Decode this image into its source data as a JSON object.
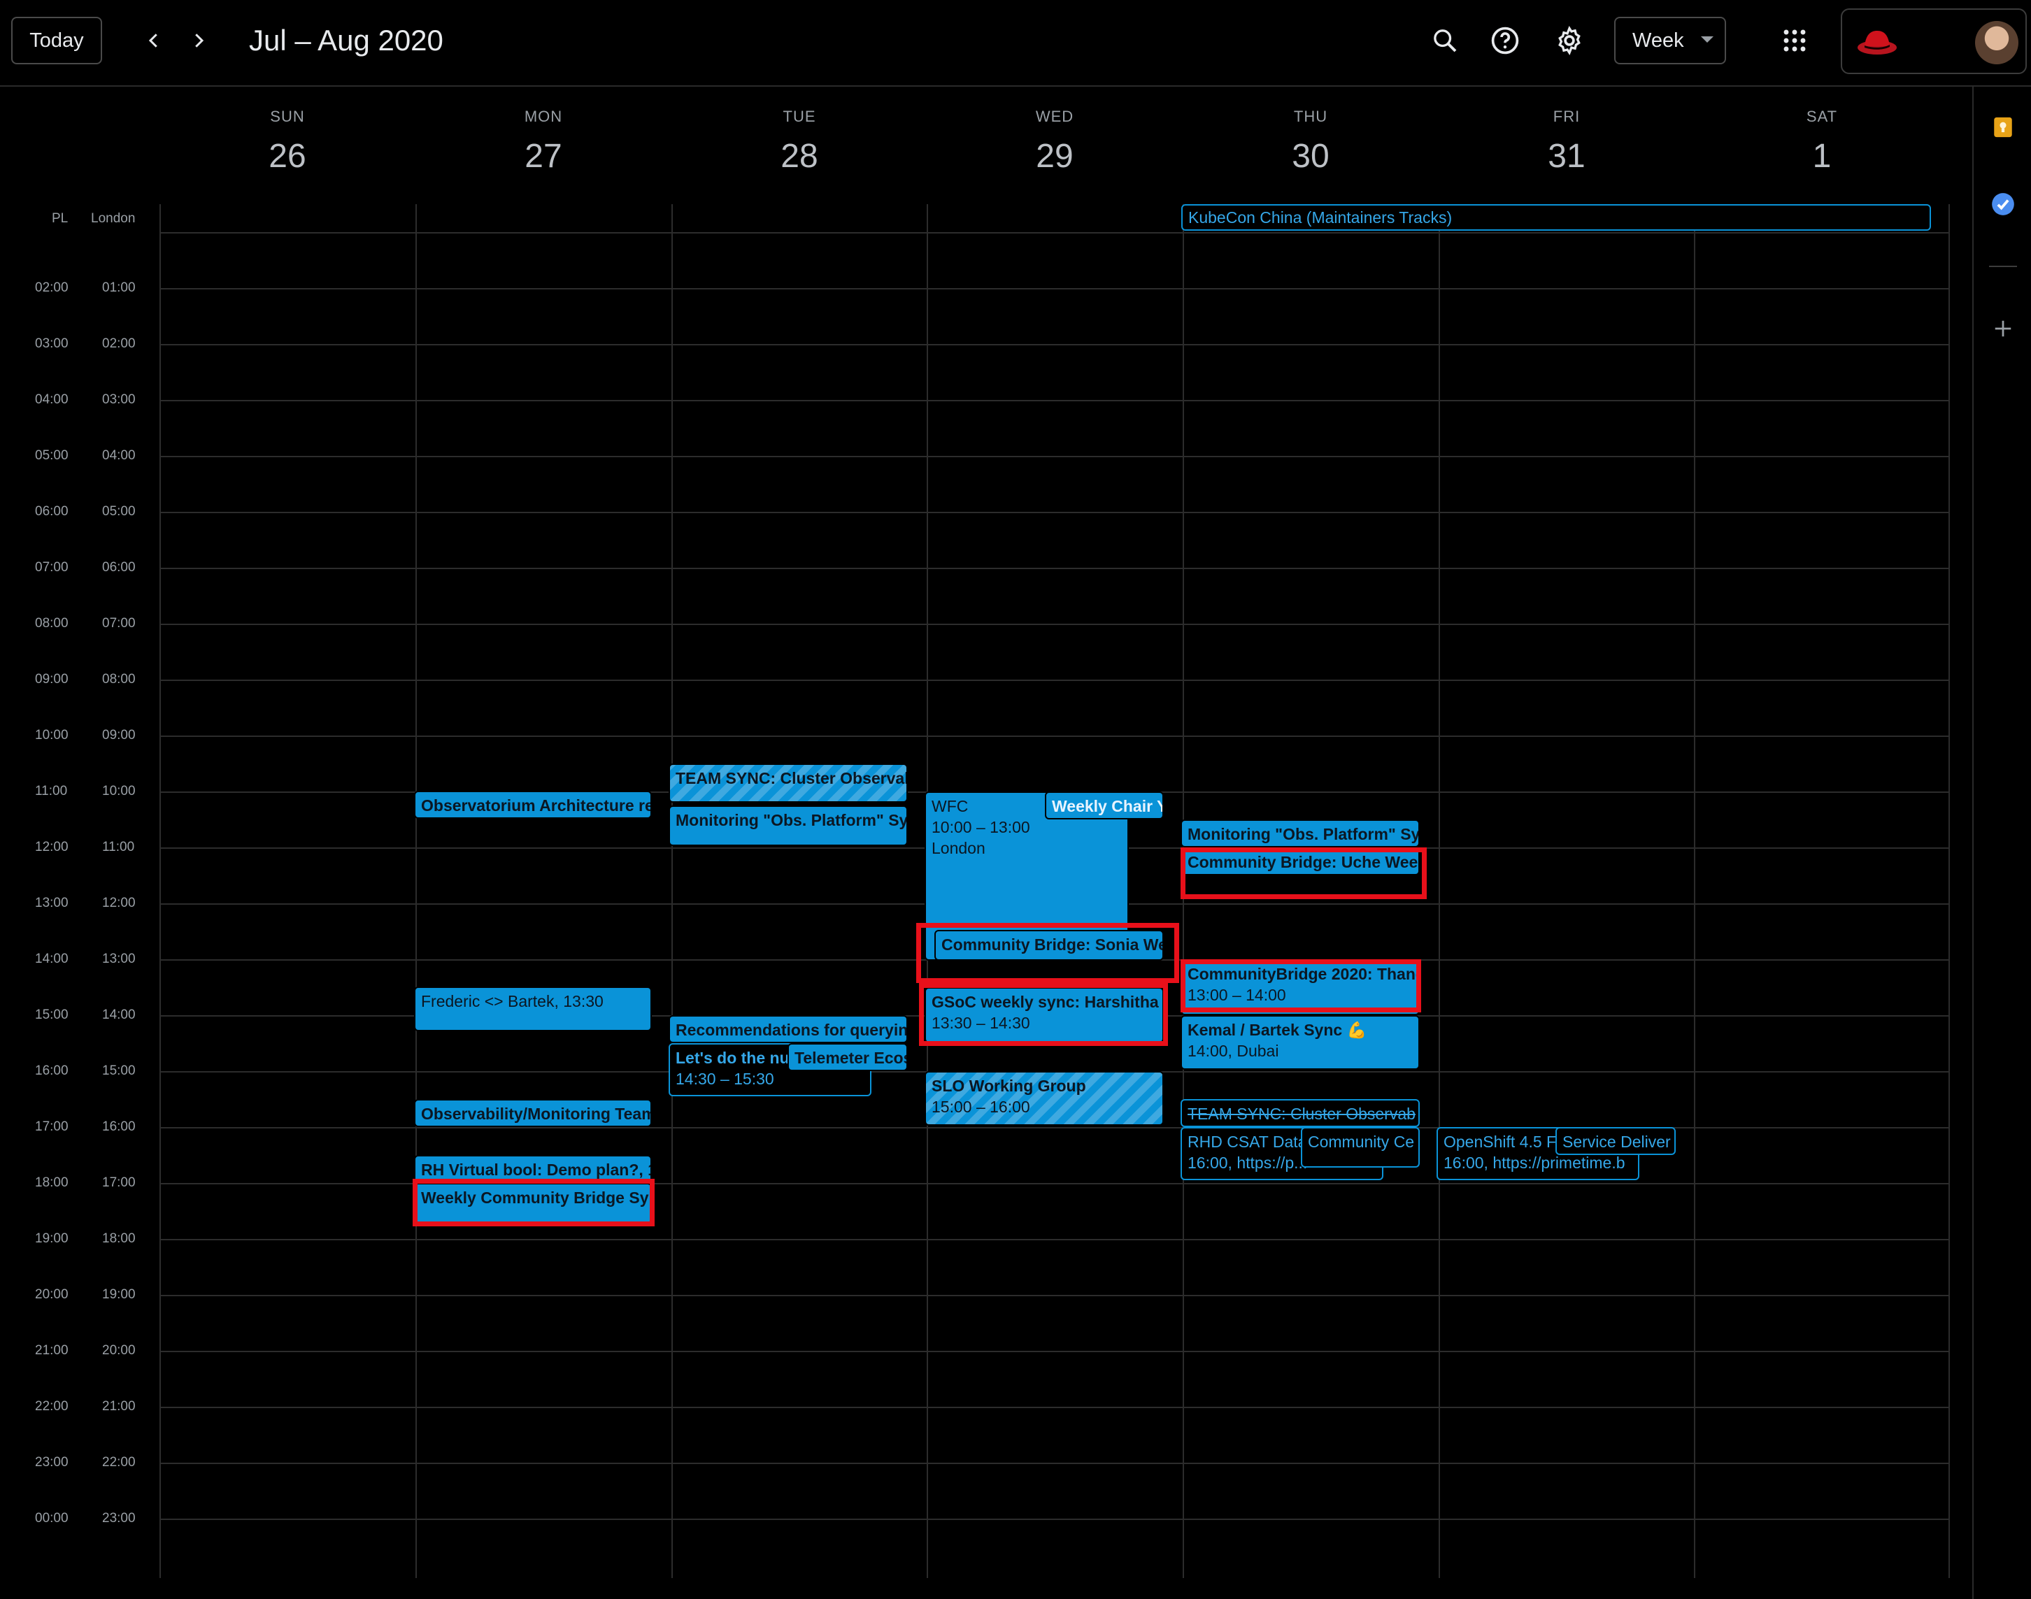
{
  "header": {
    "today_label": "Today",
    "date_range": "Jul – Aug 2020",
    "view_label": "Week",
    "icons": [
      "chevron-left-icon",
      "chevron-right-icon",
      "search-icon",
      "help-icon",
      "settings-icon",
      "apps-grid-icon",
      "redhat-logo",
      "avatar"
    ]
  },
  "side_panel": {
    "icons": [
      "keep-icon",
      "tasks-icon",
      "add-icon"
    ]
  },
  "timezones": [
    "PL",
    "London"
  ],
  "days": [
    {
      "name": "SUN",
      "num": "26"
    },
    {
      "name": "MON",
      "num": "27"
    },
    {
      "name": "TUE",
      "num": "28"
    },
    {
      "name": "WED",
      "num": "29"
    },
    {
      "name": "THU",
      "num": "30"
    },
    {
      "name": "FRI",
      "num": "31"
    },
    {
      "name": "SAT",
      "num": "1"
    }
  ],
  "times_pl": [
    "02:00",
    "03:00",
    "04:00",
    "05:00",
    "06:00",
    "07:00",
    "08:00",
    "09:00",
    "10:00",
    "11:00",
    "12:00",
    "13:00",
    "14:00",
    "15:00",
    "16:00",
    "17:00",
    "18:00",
    "19:00",
    "20:00",
    "21:00",
    "22:00",
    "23:00",
    "00:00"
  ],
  "times_london": [
    "01:00",
    "02:00",
    "03:00",
    "04:00",
    "05:00",
    "06:00",
    "07:00",
    "08:00",
    "09:00",
    "10:00",
    "11:00",
    "12:00",
    "13:00",
    "14:00",
    "15:00",
    "16:00",
    "17:00",
    "18:00",
    "19:00",
    "20:00",
    "21:00",
    "22:00",
    "23:00"
  ],
  "allday": {
    "title": "KubeCon China (Maintainers Tracks)"
  },
  "events": {
    "mon_obs_arch": {
      "title": "Observatorium Architecture re"
    },
    "mon_frederic": {
      "title": "Frederic <> Bartek, 13:30"
    },
    "mon_obs_mon_team": {
      "title": "Observability/Monitoring Team"
    },
    "mon_rh_virtual": {
      "title": "RH Virtual bool: Demo plan?, 1"
    },
    "mon_weekly_cb": {
      "title": "Weekly Community Bridge Syr"
    },
    "tue_team_sync": {
      "title": "TEAM SYNC: Cluster Observab"
    },
    "tue_monitoring": {
      "title": "Monitoring \"Obs. Platform\" Syr"
    },
    "tue_recommendations": {
      "title": "Recommendations for queryin"
    },
    "tue_lets_do": {
      "title": "Let's do the nu",
      "time": "14:30 – 15:30"
    },
    "tue_telemeter": {
      "title": "Telemeter Ecos"
    },
    "wed_wfc": {
      "title": "WFC",
      "time": "10:00 – 13:00",
      "location": "London"
    },
    "wed_weekly_chair": {
      "title": "Weekly Chair Y"
    },
    "wed_cb_sonia": {
      "title": "Community Bridge: Sonia We"
    },
    "wed_gsoc": {
      "title": "GSoC weekly sync: Harshitha",
      "time": "13:30 – 14:30"
    },
    "wed_slo": {
      "title": "SLO Working Group",
      "time": "15:00 – 16:00"
    },
    "thu_monitoring": {
      "title": "Monitoring \"Obs. Platform\" Syr"
    },
    "thu_cb_uche": {
      "title": "Community Bridge: Uche Week"
    },
    "thu_cb2020": {
      "title": "CommunityBridge 2020: Thanc",
      "time": "13:00 – 14:00"
    },
    "thu_kemal": {
      "title": "Kemal / Bartek Sync 💪",
      "time": "14:00, Dubai"
    },
    "thu_team_sync": {
      "title": "TEAM SYNC: Cluster Observab"
    },
    "thu_rhd_csat": {
      "title": "RHD CSAT Data",
      "time": "16:00, https://p..."
    },
    "thu_community_ce": {
      "title": "Community Ce"
    },
    "fri_openshift": {
      "title": "OpenShift 4.5 F",
      "time": "16:00, https://primetime.b"
    },
    "fri_service_deliver": {
      "title": "Service Deliver"
    }
  },
  "colors": {
    "event": "#0a93d8",
    "highlight": "#e8101a",
    "background": "#000000"
  }
}
